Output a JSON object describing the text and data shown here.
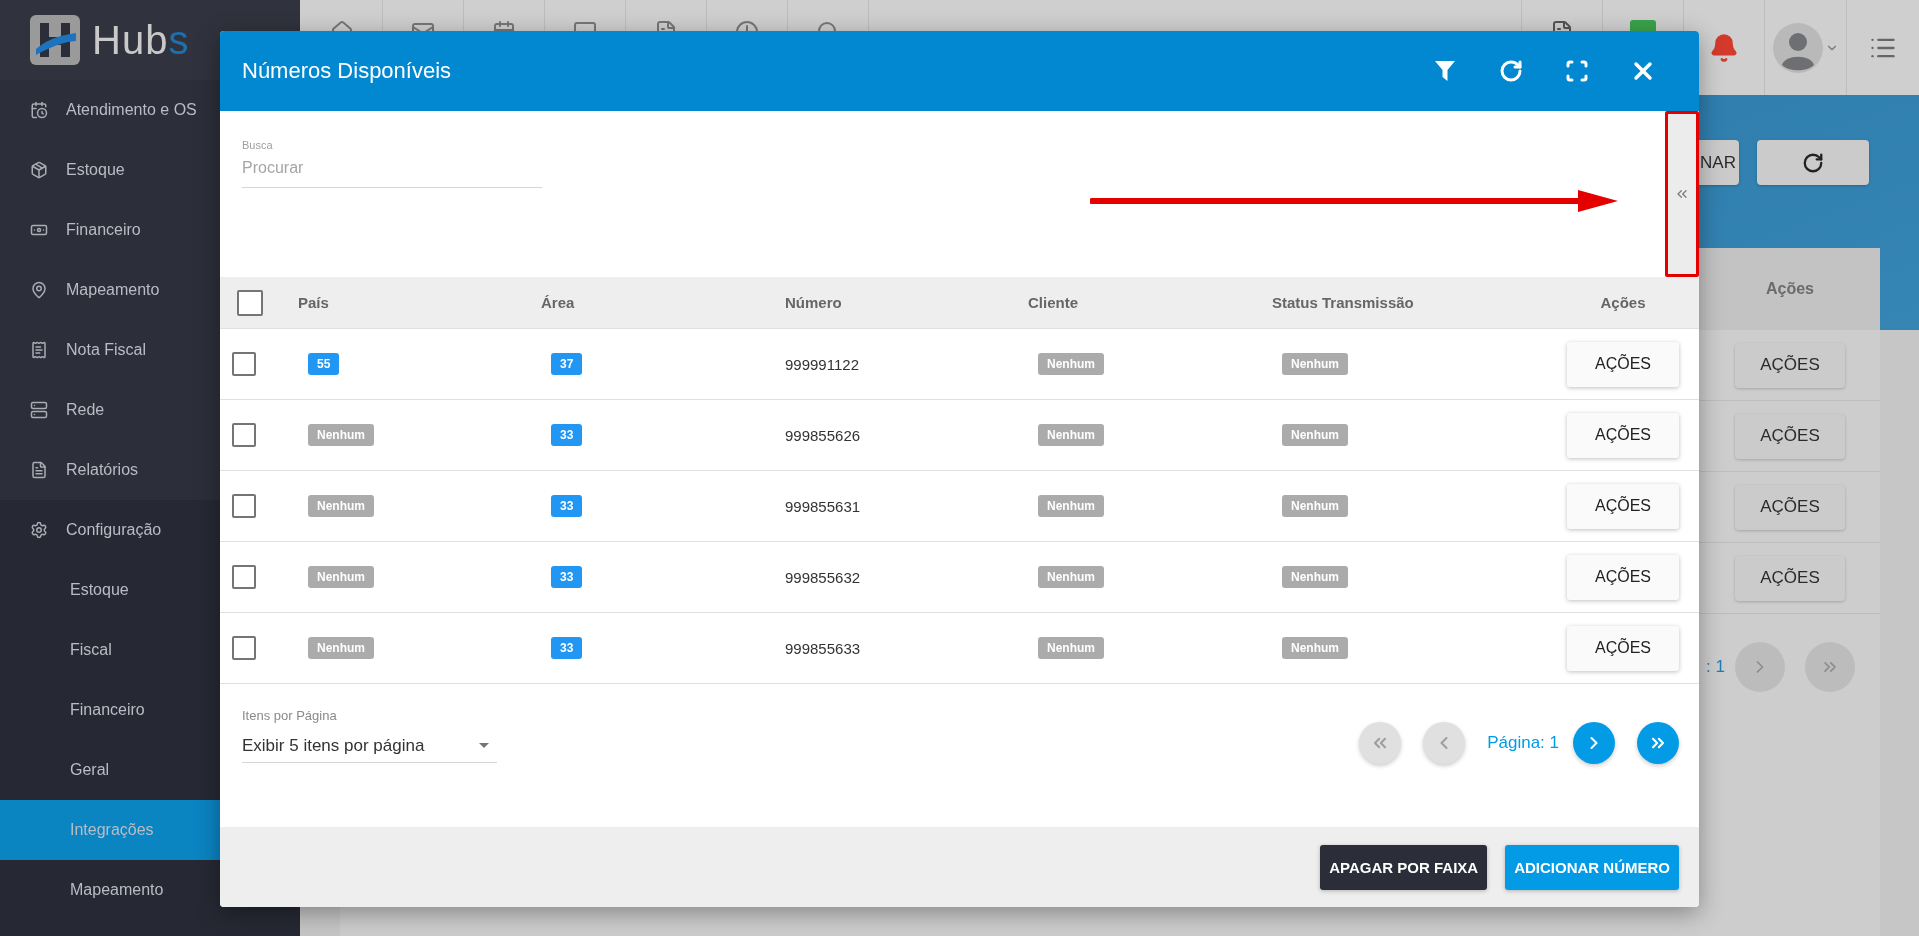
{
  "sidebar": {
    "logo": {
      "text": "Hub",
      "accent": "s"
    },
    "items": [
      {
        "label": "Atendimento e OS",
        "selected": false
      },
      {
        "label": "Estoque",
        "selected": false
      },
      {
        "label": "Financeiro",
        "selected": false
      },
      {
        "label": "Mapeamento",
        "selected": false
      },
      {
        "label": "Nota Fiscal",
        "selected": false
      },
      {
        "label": "Rede",
        "selected": false
      },
      {
        "label": "Relatórios",
        "selected": false
      },
      {
        "label": "Configuração",
        "selected": false,
        "children": [
          {
            "label": "Estoque",
            "selected": false
          },
          {
            "label": "Fiscal",
            "selected": false
          },
          {
            "label": "Financeiro",
            "selected": false
          },
          {
            "label": "Geral",
            "selected": false
          },
          {
            "label": "Integrações",
            "selected": true
          },
          {
            "label": "Mapeamento",
            "selected": false
          }
        ]
      }
    ]
  },
  "background": {
    "toolbar_button": "NAR",
    "table_header": "Ações",
    "row_actions": [
      "AÇÕES",
      "AÇÕES",
      "AÇÕES",
      "AÇÕES"
    ],
    "pagination_text": ": 1"
  },
  "modal": {
    "title": "Números Disponíveis",
    "search": {
      "label": "Busca",
      "placeholder": "Procurar"
    },
    "table": {
      "select_all_checked": false,
      "columns": [
        "País",
        "Área",
        "Número",
        "Cliente",
        "Status Transmissão",
        "Ações"
      ],
      "rows": [
        {
          "checked": false,
          "pais": {
            "kind": "value",
            "text": "55"
          },
          "area": {
            "kind": "value",
            "text": "37"
          },
          "numero": "999991122",
          "cliente": {
            "kind": "empty",
            "text": "Nenhum"
          },
          "status": {
            "kind": "empty",
            "text": "Nenhum"
          },
          "action": "AÇÕES"
        },
        {
          "checked": false,
          "pais": {
            "kind": "empty",
            "text": "Nenhum"
          },
          "area": {
            "kind": "value",
            "text": "33"
          },
          "numero": "999855626",
          "cliente": {
            "kind": "empty",
            "text": "Nenhum"
          },
          "status": {
            "kind": "empty",
            "text": "Nenhum"
          },
          "action": "AÇÕES"
        },
        {
          "checked": false,
          "pais": {
            "kind": "empty",
            "text": "Nenhum"
          },
          "area": {
            "kind": "value",
            "text": "33"
          },
          "numero": "999855631",
          "cliente": {
            "kind": "empty",
            "text": "Nenhum"
          },
          "status": {
            "kind": "empty",
            "text": "Nenhum"
          },
          "action": "AÇÕES"
        },
        {
          "checked": false,
          "pais": {
            "kind": "empty",
            "text": "Nenhum"
          },
          "area": {
            "kind": "value",
            "text": "33"
          },
          "numero": "999855632",
          "cliente": {
            "kind": "empty",
            "text": "Nenhum"
          },
          "status": {
            "kind": "empty",
            "text": "Nenhum"
          },
          "action": "AÇÕES"
        },
        {
          "checked": false,
          "pais": {
            "kind": "empty",
            "text": "Nenhum"
          },
          "area": {
            "kind": "value",
            "text": "33"
          },
          "numero": "999855633",
          "cliente": {
            "kind": "empty",
            "text": "Nenhum"
          },
          "status": {
            "kind": "empty",
            "text": "Nenhum"
          },
          "action": "AÇÕES"
        }
      ]
    },
    "page_size": {
      "label": "Itens por Página",
      "value": "Exibir 5 itens por página"
    },
    "pagination": {
      "label": "Página: 1",
      "before": [
        {
          "kind": "first",
          "disabled": true
        },
        {
          "kind": "prev",
          "disabled": true
        }
      ],
      "after": [
        {
          "kind": "next",
          "disabled": false
        },
        {
          "kind": "last",
          "disabled": false
        }
      ]
    },
    "footer_buttons": [
      {
        "label": "APAGAR POR FAIXA",
        "kind": "dark"
      },
      {
        "label": "ADICIONAR NÚMERO",
        "kind": "primary"
      }
    ]
  }
}
